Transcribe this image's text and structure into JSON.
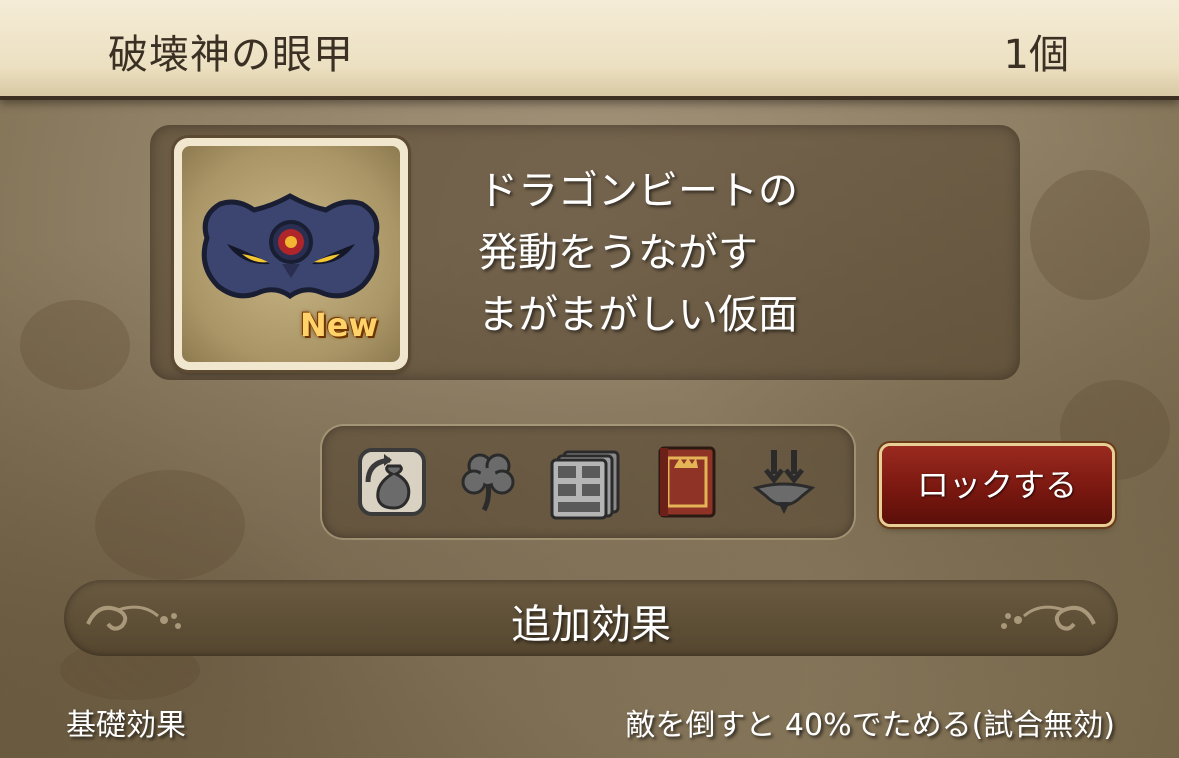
{
  "header": {
    "item_name": "破壊神の眼甲",
    "count": "1個"
  },
  "item": {
    "icon": "demon-mask-icon",
    "badge": "New",
    "description_lines": [
      "ドラゴンビートの",
      "発動をうながす",
      "まがまがしい仮面"
    ]
  },
  "actions": {
    "icons": [
      "sell-bag-icon",
      "clover-icon",
      "storage-drawer-icon",
      "book-icon",
      "gem-fusion-icon"
    ],
    "lock_label": "ロックする"
  },
  "effects": {
    "section_title": "追加効果",
    "rows": [
      {
        "label": "基礎効果",
        "value": "敵を倒すと 40%でためる(試合無効)"
      }
    ]
  },
  "colors": {
    "header_bg": "#ece0c1",
    "lock_button": "#7a1810",
    "parchment": "#8f7f64"
  }
}
